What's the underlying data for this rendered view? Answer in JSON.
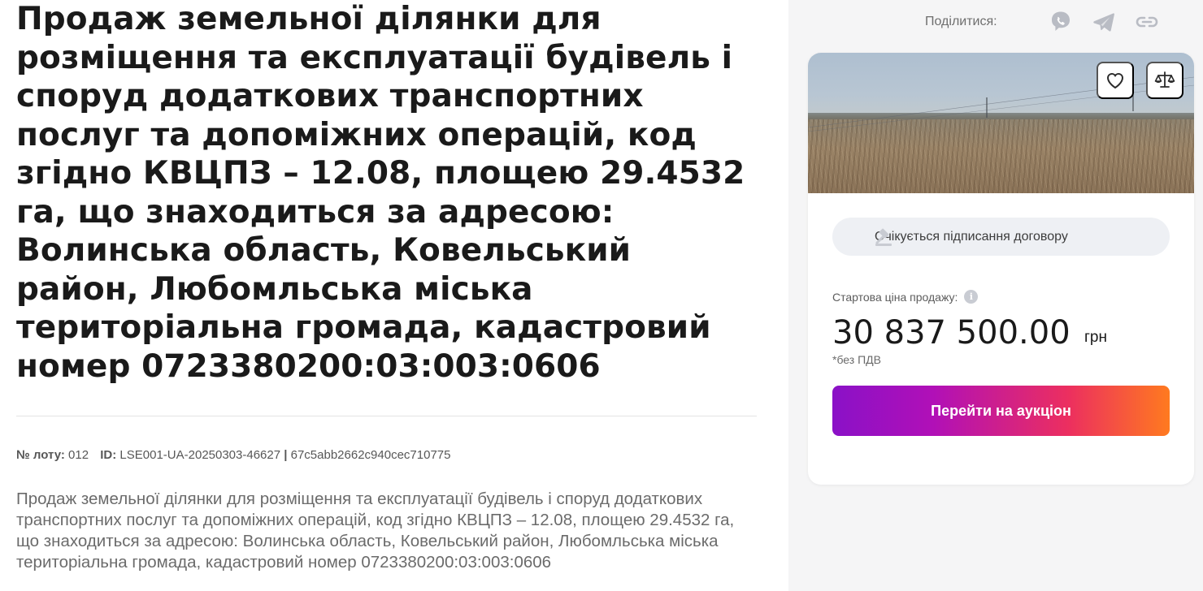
{
  "lot": {
    "title": "Продаж земельної ділянки для розміщення та експлуатації будівель і споруд додаткових транспортних послуг та допоміжних операцій, код згідно КВЦПЗ – 12.08, площею 29.4532 га, що знаходиться за адресою: Волинська область, Ковельський район, Любомльська міська територіальна громада, кадастровий номер 0723380200:03:003:0606",
    "lot_number_label": "№ лоту:",
    "lot_number": "012",
    "id_label": "ID:",
    "id_value": "LSE001-UA-20250303-46627",
    "separator": "|",
    "hash": "67c5abb2662c940cec710775",
    "description": "Продаж земельної ділянки для розміщення та експлуатації будівель і споруд додаткових транспортних послуг та допоміжних операцій, код згідно КВЦПЗ – 12.08, площею 29.4532 га, що знаходиться за адресою: Волинська область, Ковельський район, Любомльська міська територіальна громада, кадастровий номер 0723380200:03:003:0606"
  },
  "share": {
    "label": "Поділитися:",
    "icons": [
      "viber-icon",
      "telegram-icon",
      "link-icon"
    ]
  },
  "card": {
    "photo_alt": "Поле з сухою травою",
    "favorite_icon": "heart-icon",
    "compare_icon": "scales-icon",
    "status": "Очікується підписання договору",
    "status_icon": "gavel-icon",
    "price_label": "Стартова ціна продажу:",
    "info_icon_glyph": "i",
    "price": "30 837 500.00",
    "currency": "грн",
    "vat_note": "*без ПДВ",
    "cta_label": "Перейти на аукціон"
  },
  "colors": {
    "cta_gradient_start": "#8a11c7",
    "cta_gradient_end": "#ff7a1f",
    "right_panel_bg": "#f5f5f6",
    "status_bg": "#eef0f4",
    "icon_gray": "#b9bcc4"
  }
}
